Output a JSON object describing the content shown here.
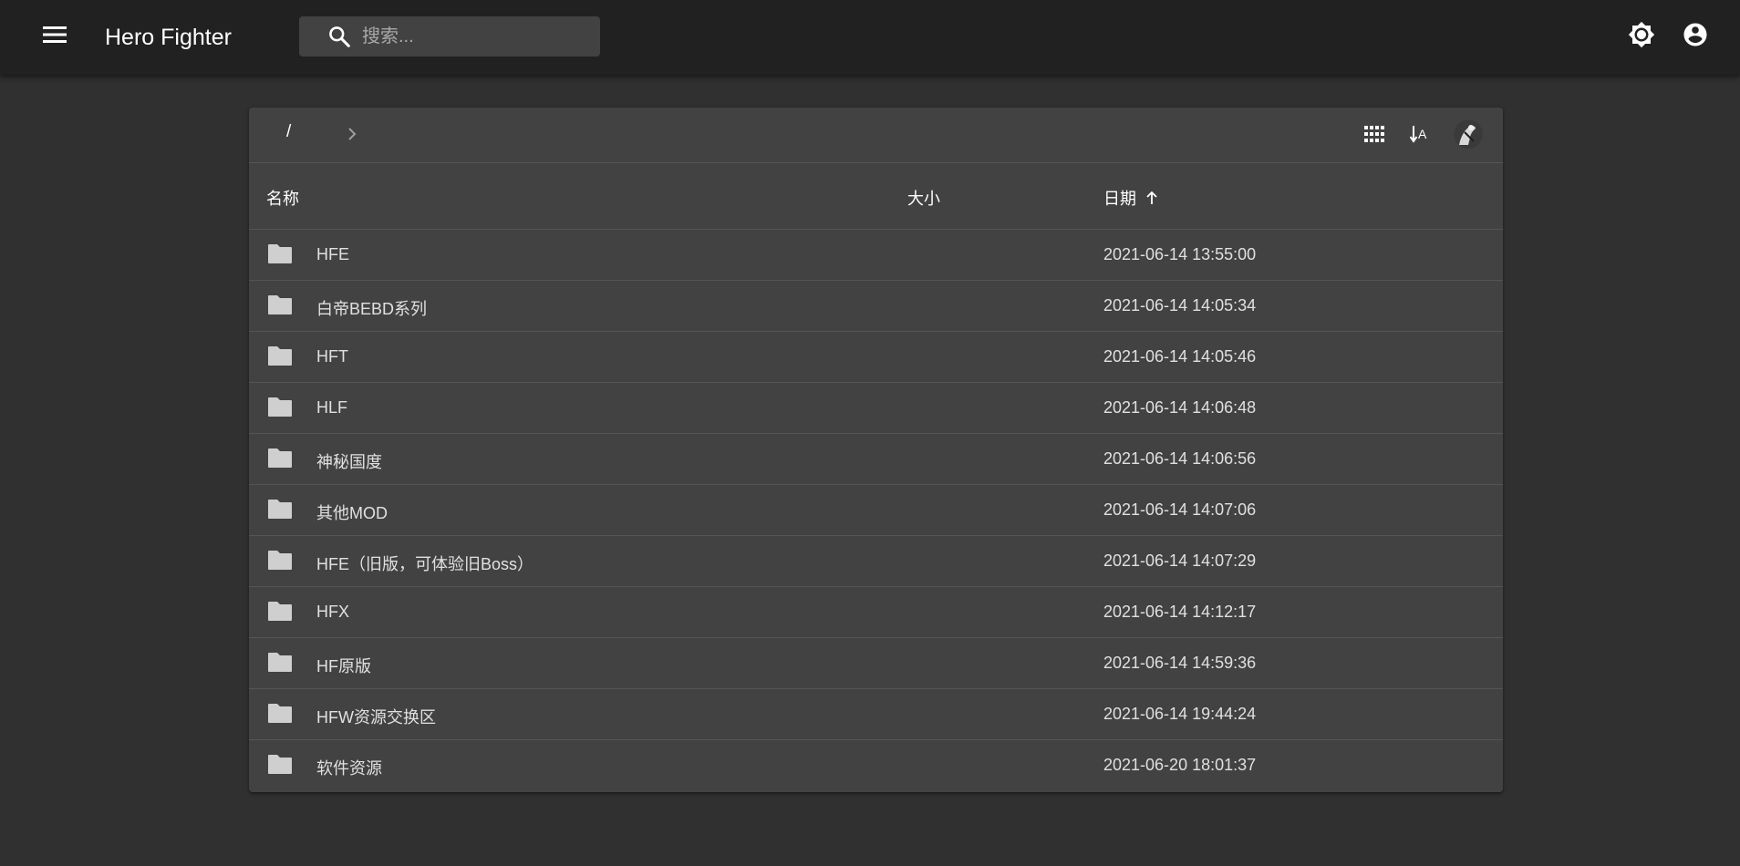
{
  "appbar": {
    "title": "Hero Fighter",
    "search_placeholder": "搜索...",
    "icons": [
      "menu-icon",
      "search-icon",
      "brightness-icon",
      "account-icon"
    ]
  },
  "toolbar": {
    "breadcrumb_root": "/",
    "icons": [
      "chevron-right-icon",
      "grid-view-icon",
      "sort-icon",
      "avatar"
    ]
  },
  "table": {
    "headers": {
      "name": "名称",
      "size": "大小",
      "date": "日期",
      "sort_direction": "ascending"
    },
    "rows": [
      {
        "name": "HFE",
        "size": "",
        "date": "2021-06-14 13:55:00",
        "type": "folder"
      },
      {
        "name": "白帝BEBD系列",
        "size": "",
        "date": "2021-06-14 14:05:34",
        "type": "folder"
      },
      {
        "name": "HFT",
        "size": "",
        "date": "2021-06-14 14:05:46",
        "type": "folder"
      },
      {
        "name": "HLF",
        "size": "",
        "date": "2021-06-14 14:06:48",
        "type": "folder"
      },
      {
        "name": "神秘国度",
        "size": "",
        "date": "2021-06-14 14:06:56",
        "type": "folder"
      },
      {
        "name": "其他MOD",
        "size": "",
        "date": "2021-06-14 14:07:06",
        "type": "folder"
      },
      {
        "name": "HFE（旧版，可体验旧Boss）",
        "size": "",
        "date": "2021-06-14 14:07:29",
        "type": "folder"
      },
      {
        "name": "HFX",
        "size": "",
        "date": "2021-06-14 14:12:17",
        "type": "folder"
      },
      {
        "name": "HF原版",
        "size": "",
        "date": "2021-06-14 14:59:36",
        "type": "folder"
      },
      {
        "name": "HFW资源交换区",
        "size": "",
        "date": "2021-06-14 19:44:24",
        "type": "folder"
      },
      {
        "name": "软件资源",
        "size": "",
        "date": "2021-06-20 18:01:37",
        "type": "folder"
      }
    ]
  },
  "colors": {
    "background": "#303030",
    "appbar": "#212121",
    "panel": "#424242",
    "search_box": "#424242",
    "divider": "#555555",
    "folder_icon": "#cfcfcf"
  }
}
